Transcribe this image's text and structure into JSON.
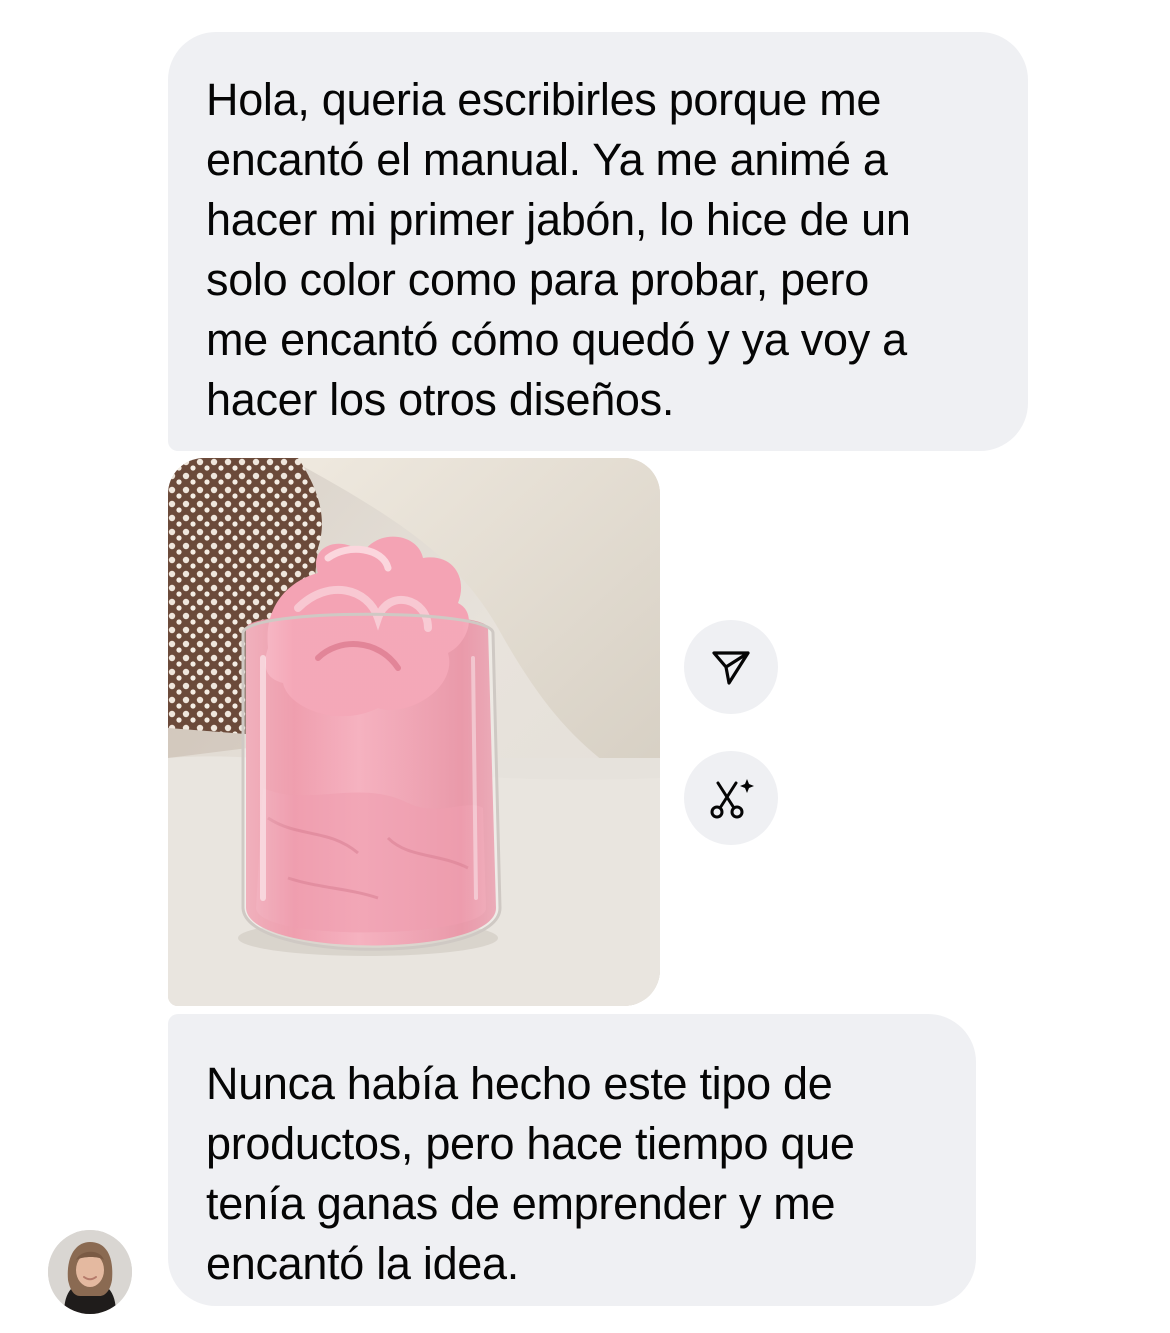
{
  "messages": [
    {
      "lines": [
        "Hola, queria escribirles porque me",
        "encantó el manual. Ya me animé a",
        "hacer mi primer jabón, lo hice de un",
        "solo color como para probar, pero",
        "me encantó cómo quedó y ya voy a",
        "hacer los otros diseños."
      ]
    },
    {
      "lines": [
        "Nunca había hecho este tipo de",
        "productos, pero hace tiempo que",
        "tenía ganas de emprender y me",
        "encantó la idea."
      ]
    }
  ],
  "photo": {
    "subject": "jar-of-pink-whipped-soap"
  },
  "actions": {
    "share_icon": "paper-plane-icon",
    "cutout_icon": "scissors-sparkle-icon"
  },
  "colors": {
    "bubble": "#eff0f3",
    "text": "#050505",
    "soap_pink": "#f3a6b4"
  }
}
